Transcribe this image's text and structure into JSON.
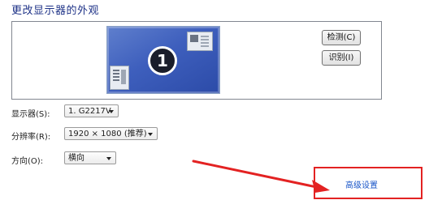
{
  "heading": "更改显示器的外观",
  "preview": {
    "monitor_number": "1"
  },
  "buttons": {
    "detect": "检测(C)",
    "identify": "识别(I)"
  },
  "settings": {
    "display": {
      "label": "显示器(S):",
      "value": "1. G2217V"
    },
    "resolution": {
      "label": "分辨率(R):",
      "value": "1920 × 1080 (推荐)"
    },
    "orientation": {
      "label": "方向(O):",
      "value": "横向"
    }
  },
  "advanced_link": "高级设置",
  "colors": {
    "heading": "#1e3287",
    "link": "#1a56c8",
    "annotation_red": "#e32222",
    "monitor_blue": "#3e5fbd"
  },
  "icons": {
    "annotation_arrow": "red-arrow-icon",
    "dropdown_arrow": "chevron-down-icon"
  }
}
